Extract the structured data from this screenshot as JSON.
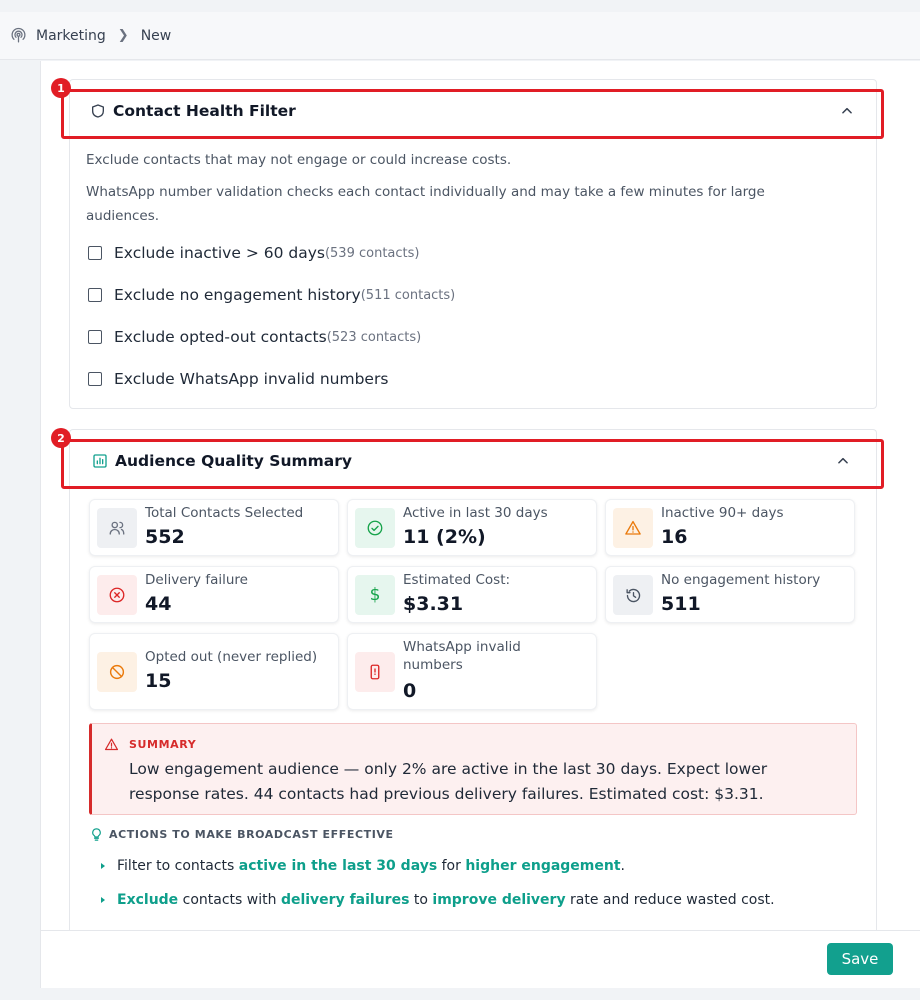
{
  "breadcrumb": {
    "section": "Marketing",
    "current": "New"
  },
  "colors": {
    "accent": "#12a08e",
    "highlight": "#e11d25",
    "danger": "#d62b2b"
  },
  "contact_health": {
    "badge": "1",
    "title": "Contact Health Filter",
    "desc1": "Exclude contacts that may not engage or could increase costs.",
    "desc2_line1": "WhatsApp number validation checks each contact individually and may take a few minutes for large",
    "desc2_line2": "audiences.",
    "filters": [
      {
        "label": "Exclude inactive > 60 days",
        "count": "(539 contacts)",
        "checked": false
      },
      {
        "label": "Exclude no engagement history",
        "count": "(511 contacts)",
        "checked": false
      },
      {
        "label": "Exclude opted-out contacts",
        "count": "(523 contacts)",
        "checked": false
      },
      {
        "label": "Exclude WhatsApp invalid numbers",
        "count": "",
        "checked": false
      }
    ]
  },
  "audience_quality": {
    "badge": "2",
    "title": "Audience Quality Summary",
    "stats": [
      {
        "label": "Total Contacts Selected",
        "value": "552",
        "icon": "users-icon"
      },
      {
        "label": "Active in last 30 days",
        "value": "11 (2%)",
        "icon": "check-circle-icon"
      },
      {
        "label": "Inactive 90+ days",
        "value": "16",
        "icon": "warning-icon"
      },
      {
        "label": "Delivery failure",
        "value": "44",
        "icon": "x-circle-icon"
      },
      {
        "label": "Estimated Cost:",
        "value": "$3.31",
        "icon": "dollar-icon"
      },
      {
        "label": "No engagement history",
        "value": "511",
        "icon": "history-icon"
      },
      {
        "label": "Opted out (never replied)",
        "value": "15",
        "icon": "ban-icon"
      },
      {
        "label_line1": "WhatsApp invalid",
        "label_line2": "numbers",
        "value": "0",
        "icon": "phone-icon"
      }
    ],
    "summary": {
      "title": "SUMMARY",
      "line1": "Low engagement audience — only 2% are active in the last 30 days. Expect lower",
      "line2": "response rates. 44 contacts had previous delivery failures. Estimated cost: $3.31."
    },
    "actions_title": "ACTIONS TO MAKE BROADCAST EFFECTIVE",
    "actions": [
      {
        "p1": "Filter to contacts ",
        "h1": "active in the last 30 days",
        "p2": " for ",
        "h2": "higher engagement",
        "p3": "."
      },
      {
        "h0": "Exclude",
        "p1": " contacts with ",
        "h1": "delivery failures",
        "p2": " to ",
        "h2": "improve delivery",
        "p3": " rate and reduce wasted cost."
      }
    ]
  },
  "footer": {
    "save_label": "Save"
  }
}
